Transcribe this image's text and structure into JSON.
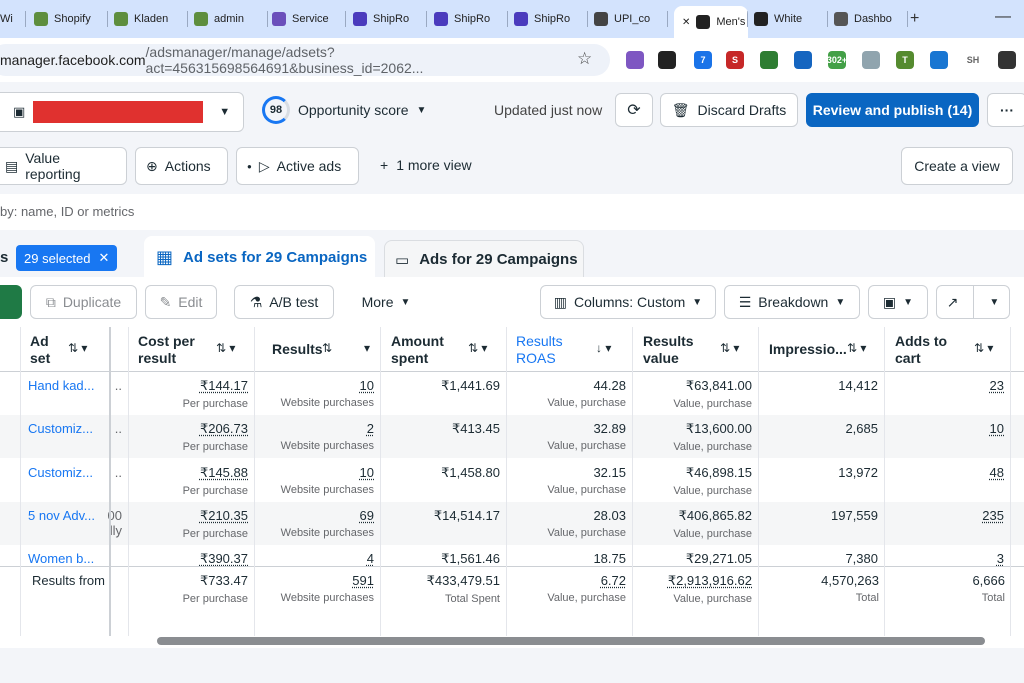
{
  "browser": {
    "tabs": [
      {
        "label": "Wi",
        "color": "#5b8f3a"
      },
      {
        "label": "Shopify",
        "color": "#5e8e3e"
      },
      {
        "label": "Kladen",
        "color": "#5e8e3e"
      },
      {
        "label": "admin",
        "color": "#5e8e3e"
      },
      {
        "label": "Service",
        "color": "#6b4fbb"
      },
      {
        "label": "ShipRo",
        "color": "#4b3bbd"
      },
      {
        "label": "ShipRo",
        "color": "#4b3bbd"
      },
      {
        "label": "ShipRo",
        "color": "#4b3bbd"
      },
      {
        "label": "UPI_co",
        "color": "#444444"
      },
      {
        "label": "Men's",
        "color": "#222222"
      },
      {
        "label": "White",
        "color": "#222222"
      },
      {
        "label": "Dashbo",
        "color": "#555555"
      }
    ],
    "new_tab": "+",
    "minimize": "—",
    "url_host": "manager.facebook.com",
    "url_rest": "/adsmanager/manage/adsets?act=456315698564691&business_id=2062...",
    "extensions": [
      {
        "label": "",
        "color": "#7e57c2"
      },
      {
        "label": "",
        "color": "#222222"
      },
      {
        "label": "7",
        "color": "#1a73e8"
      },
      {
        "label": "S",
        "color": "#c62828"
      },
      {
        "label": "",
        "color": "#2e7d32"
      },
      {
        "label": "",
        "color": "#1565c0"
      },
      {
        "label": "302+",
        "color": "#43a047"
      },
      {
        "label": "",
        "color": "#90a4ae"
      },
      {
        "label": "T",
        "color": "#558b2f"
      },
      {
        "label": "",
        "color": "#1976d2"
      },
      {
        "label": "SH",
        "color": "#9e9e9e"
      },
      {
        "label": "",
        "color": "#333333"
      }
    ]
  },
  "topbar": {
    "opportunity_score": "98",
    "opportunity_label": "Opportunity score",
    "updated": "Updated just now",
    "discard": "Discard Drafts",
    "publish": "Review and publish (14)",
    "more": "···"
  },
  "views": {
    "value_reporting": "Value reporting",
    "actions": "Actions",
    "active_ads": "Active ads",
    "more_view": "1 more view",
    "create_view": "Create a view"
  },
  "search": {
    "placeholder": "by: name, ID or metrics"
  },
  "level": {
    "campaigns_prefix": "s",
    "selected": "29 selected",
    "adsets_tab": "Ad sets for 29 Campaigns",
    "ads_tab": "Ads for 29 Campaigns"
  },
  "toolbar": {
    "duplicate": "Duplicate",
    "edit": "Edit",
    "abtest": "A/B test",
    "more": "More",
    "columns": "Columns: Custom",
    "breakdown": "Breakdown"
  },
  "table": {
    "headers": {
      "adset": "Ad set",
      "cost": "Cost per result",
      "results": "Results",
      "amount": "Amount spent",
      "roas": "Results ROAS",
      "value": "Results value",
      "impressions": "Impressio...",
      "addtocart": "Adds to cart"
    },
    "rows": [
      {
        "name": "Hand kad...",
        "mid": "..",
        "cost": "₹144.17",
        "cost_sub": "Per purchase",
        "results": "10",
        "results_sub": "Website purchases",
        "amount": "₹1,441.69",
        "roas": "44.28",
        "roas_sub": "Value, purchase",
        "value": "₹63,841.00",
        "value_sub": "Value, purchase",
        "impressions": "14,412",
        "cart": "23"
      },
      {
        "name": "Customiz...",
        "mid": "..",
        "cost": "₹206.73",
        "cost_sub": "Per purchase",
        "results": "2",
        "results_sub": "Website purchases",
        "amount": "₹413.45",
        "roas": "32.89",
        "roas_sub": "Value, purchase",
        "value": "₹13,600.00",
        "value_sub": "Value, purchase",
        "impressions": "2,685",
        "cart": "10"
      },
      {
        "name": "Customiz...",
        "mid": "..",
        "cost": "₹145.88",
        "cost_sub": "Per purchase",
        "results": "10",
        "results_sub": "Website purchases",
        "amount": "₹1,458.80",
        "roas": "32.15",
        "roas_sub": "Value, purchase",
        "value": "₹46,898.15",
        "value_sub": "Value, purchase",
        "impressions": "13,972",
        "cart": "48"
      },
      {
        "name": "5 nov Adv...",
        "mid": "00 lly",
        "cost": "₹210.35",
        "cost_sub": "Per purchase",
        "results": "69",
        "results_sub": "Website purchases",
        "amount": "₹14,514.17",
        "roas": "28.03",
        "roas_sub": "Value, purchase",
        "value": "₹406,865.82",
        "value_sub": "Value, purchase",
        "impressions": "197,559",
        "cart": "235"
      },
      {
        "name": "Women b...",
        "mid": "",
        "cost": "₹390.37",
        "cost_sub": "",
        "results": "4",
        "results_sub": "",
        "amount": "₹1,561.46",
        "roas": "18.75",
        "roas_sub": "",
        "value": "₹29,271.05",
        "value_sub": "",
        "impressions": "7,380",
        "cart": "3"
      }
    ],
    "footer": {
      "label": "Results from",
      "cost": "₹733.47",
      "cost_sub": "Per purchase",
      "results": "591",
      "results_sub": "Website purchases",
      "amount": "₹433,479.51",
      "amount_sub": "Total Spent",
      "roas": "6.72",
      "roas_sub": "Value, purchase",
      "value": "₹2,913,916.62",
      "value_sub": "Value, purchase",
      "impressions": "4,570,263",
      "impressions_sub": "Total",
      "cart": "6,666",
      "cart_sub": "Total"
    }
  }
}
